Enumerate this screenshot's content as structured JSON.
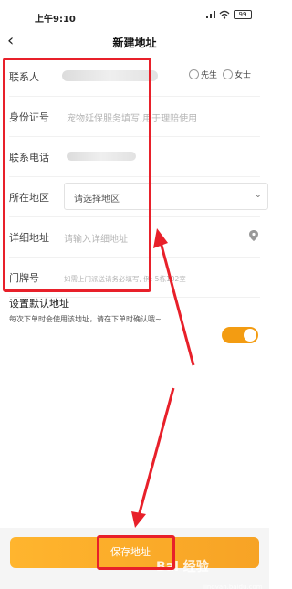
{
  "status_bar": {
    "time": "上午9:10",
    "battery": "99"
  },
  "header": {
    "title": "新建地址"
  },
  "form": {
    "contact": {
      "label": "联系人",
      "gender_options": [
        "先生",
        "女士"
      ]
    },
    "id_card": {
      "label": "身份证号",
      "placeholder": "宠物延保服务填写,用于理赔使用"
    },
    "phone": {
      "label": "联系电话"
    },
    "region": {
      "label": "所在地区",
      "placeholder": "请选择地区"
    },
    "address": {
      "label": "详细地址",
      "placeholder": "请输入详细地址"
    },
    "door": {
      "label": "门牌号",
      "placeholder": "如需上门派送请务必填写, 例: 5栋102室"
    }
  },
  "default_address": {
    "title": "设置默认地址",
    "description": "每次下单时会使用该地址，请在下单时确认哦~",
    "enabled": true
  },
  "footer": {
    "save_label": "保存地址",
    "watermark": "Bai 经验",
    "watermark_url": "jingyan.baidu.com"
  },
  "colors": {
    "accent": "#f39c12",
    "annotation": "#e8202a"
  }
}
